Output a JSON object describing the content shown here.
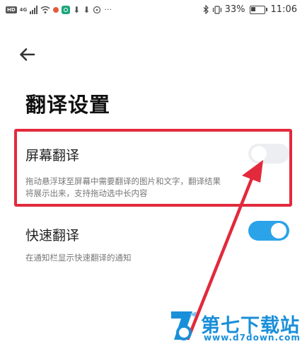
{
  "status_bar": {
    "hd_badge": "HD",
    "network_badge": "4G",
    "more_indicator": "···",
    "battery_percent": "33%",
    "time": "11:06",
    "icons": [
      "hd-icon",
      "signal-icon",
      "wifi-icon",
      "app-icon",
      "app-icon",
      "download-icon",
      "download-icon",
      "circle-icon",
      "bluetooth-icon",
      "vibrate-icon",
      "battery-icon"
    ]
  },
  "header": {
    "back_icon": "arrow-left-icon",
    "title": "翻译设置"
  },
  "settings": [
    {
      "title": "屏幕翻译",
      "description_line1": "拖动悬浮球至屏幕中需要翻译的图片和文字，翻译结果",
      "description_line2": "将展示出来，支持拖动选中长内容",
      "enabled": false
    },
    {
      "title": "快速翻译",
      "description": "在通知栏显示快速翻译的通知",
      "enabled": true
    }
  ],
  "colors": {
    "accent": "#2ba3e8",
    "highlight": "#e22a3c",
    "watermark": "#1a8fd9"
  },
  "watermark": {
    "title": "第七下载站",
    "url": "www.d7down.com"
  }
}
